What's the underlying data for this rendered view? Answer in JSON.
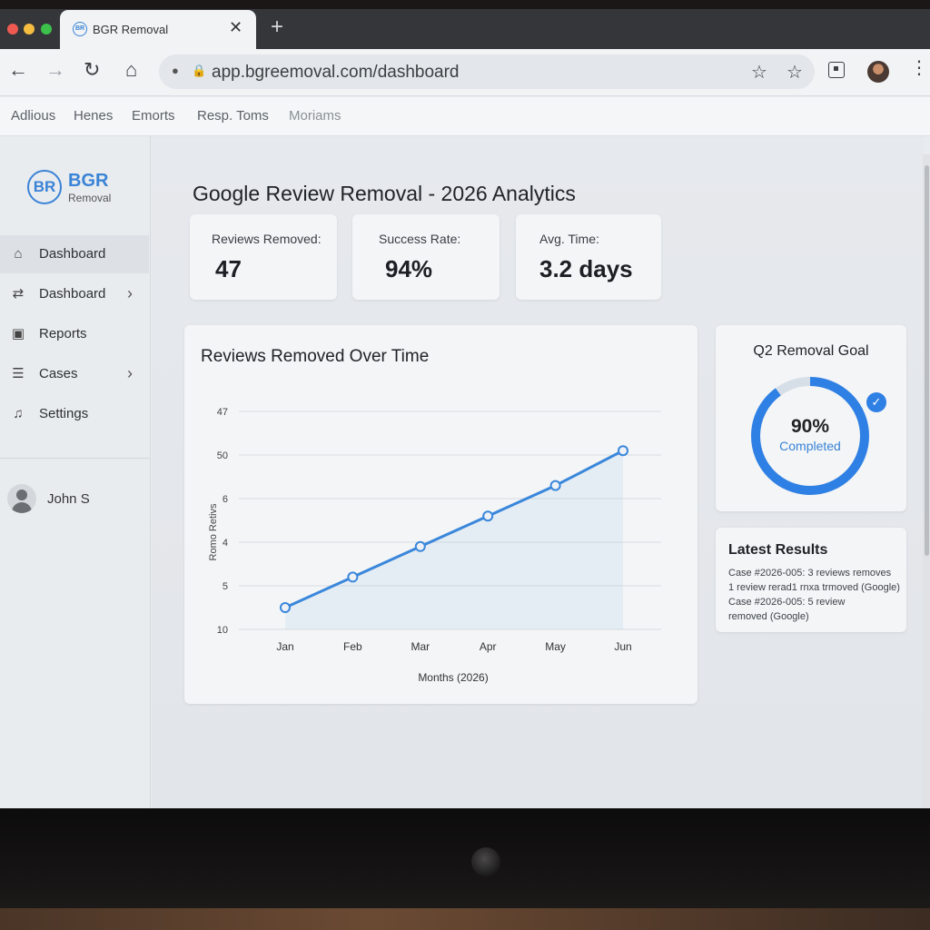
{
  "browser": {
    "tab_title": "BGR Removal",
    "tab_favicon": "BR",
    "url": "app.bgreemoval.com/dashboard",
    "icons": [
      "back-arrow-icon",
      "forward-arrow-icon",
      "reload-icon",
      "home-icon",
      "lock-icon",
      "star-icon",
      "extension-icon",
      "menu-dots-icon"
    ]
  },
  "bookmarks": [
    "Adlious",
    "Henes",
    "Emorts",
    "Resp. Toms",
    "Moriams"
  ],
  "sidebar": {
    "logo_mark": "BR",
    "logo_name": "BGR",
    "logo_sub": "Removal",
    "items": [
      {
        "label": "Dashboard",
        "icon": "home-icon",
        "active": true
      },
      {
        "label": "Dashboard",
        "icon": "sliders-icon",
        "chevron": true
      },
      {
        "label": "Reports",
        "icon": "report-icon"
      },
      {
        "label": "Cases",
        "icon": "list-icon",
        "chevron": true
      },
      {
        "label": "Settings",
        "icon": "bell-icon"
      }
    ],
    "user_name": "John S"
  },
  "page": {
    "title": "Google Review Removal - 2026 Analytics"
  },
  "kpis": [
    {
      "label": "Reviews Removed:",
      "value": "47"
    },
    {
      "label": "Success Rate:",
      "value": "94%"
    },
    {
      "label": "Avg. Time:",
      "value": "3.2 days"
    }
  ],
  "chart": {
    "title": "Reviews Removed Over Time",
    "xlabel": "Months (2026)",
    "ylabel": "Romo Retivs",
    "y_tick_labels": [
      "47",
      "50",
      "6",
      "4",
      "5",
      "10"
    ]
  },
  "chart_data": {
    "type": "line",
    "title": "Reviews Removed Over Time",
    "xlabel": "Months (2026)",
    "ylabel": "Romo Retivs",
    "categories": [
      "Jan",
      "Feb",
      "Mar",
      "Apr",
      "May",
      "Jun"
    ],
    "series": [
      {
        "values": [
          5,
          12,
          19,
          26,
          33,
          41
        ]
      }
    ],
    "ylim": [
      0,
      50
    ],
    "grid": true,
    "color": "#3a87db"
  },
  "goal": {
    "title": "Q2 Removal Goal",
    "percent_text": "90%",
    "sub": "Completed",
    "progress": 0.9,
    "accent": "#2f80e4",
    "track": "#d6dee8"
  },
  "results": {
    "title": "Latest Results",
    "lines": [
      "Case #2026-005: 3 reviews removes",
      "1 review rerad1  rnxa trmoved (Google)",
      "Case #2026-005: 5 review",
      "removed (Google)"
    ]
  }
}
